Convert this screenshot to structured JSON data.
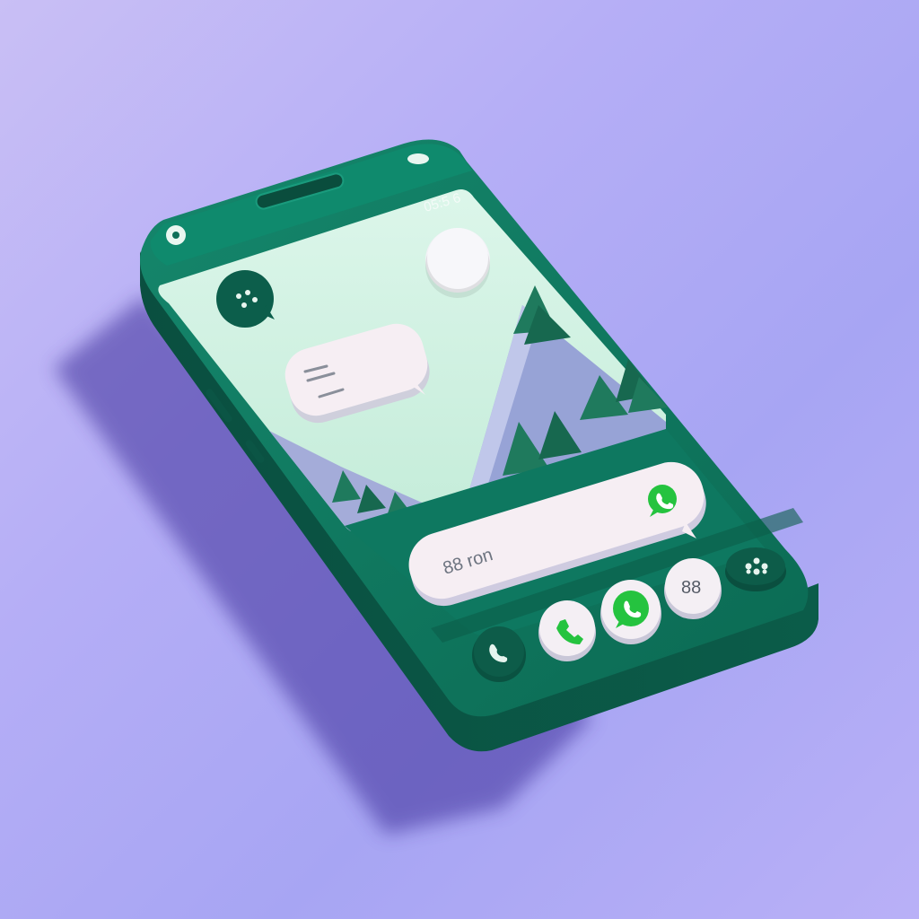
{
  "status_bar": {
    "time_text": "05:5 6"
  },
  "input_bar": {
    "value": "88 ron"
  },
  "dock": {
    "buttons": [
      {
        "icon": "phone-icon"
      },
      {
        "icon": "call-bubble-icon"
      },
      {
        "icon": "whatsapp-icon"
      },
      {
        "icon": "contacts-icon"
      },
      {
        "icon": "apps-grid-icon"
      }
    ]
  },
  "colors": {
    "background": "#b2abf5",
    "phone_body": "#0e7a62",
    "phone_side": "#0a5a47",
    "screen": "#d4f1e4",
    "mountain": "#9aa6d8",
    "tree": "#1f7a5d",
    "whatsapp_green": "#25c33f",
    "bubble": "#f5eef2"
  }
}
